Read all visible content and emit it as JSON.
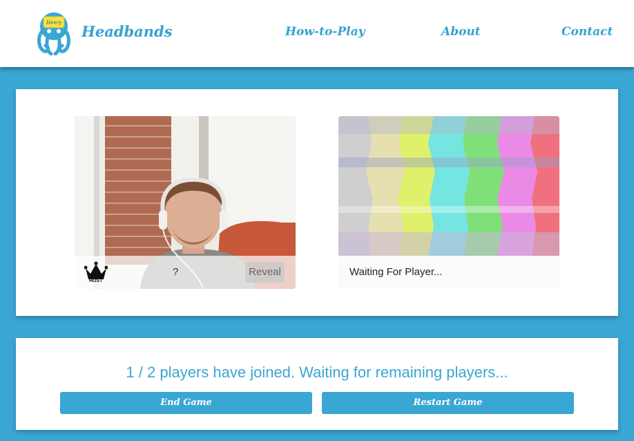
{
  "header": {
    "brand": "Headbands",
    "logo_tag": "Henry",
    "nav": {
      "how_to_play": "How-to-Play",
      "about": "About",
      "contact": "Contact"
    }
  },
  "players": [
    {
      "host_label": "HOST",
      "guess_word": "?",
      "reveal_label": "Reveal"
    },
    {
      "status": "Waiting For Player..."
    }
  ],
  "game": {
    "status": "1 / 2 players have joined. Waiting for remaining players...",
    "end_label": "End Game",
    "restart_label": "Restart Game"
  },
  "colors": {
    "accent": "#3aa6d4",
    "panel": "#ffffff"
  }
}
